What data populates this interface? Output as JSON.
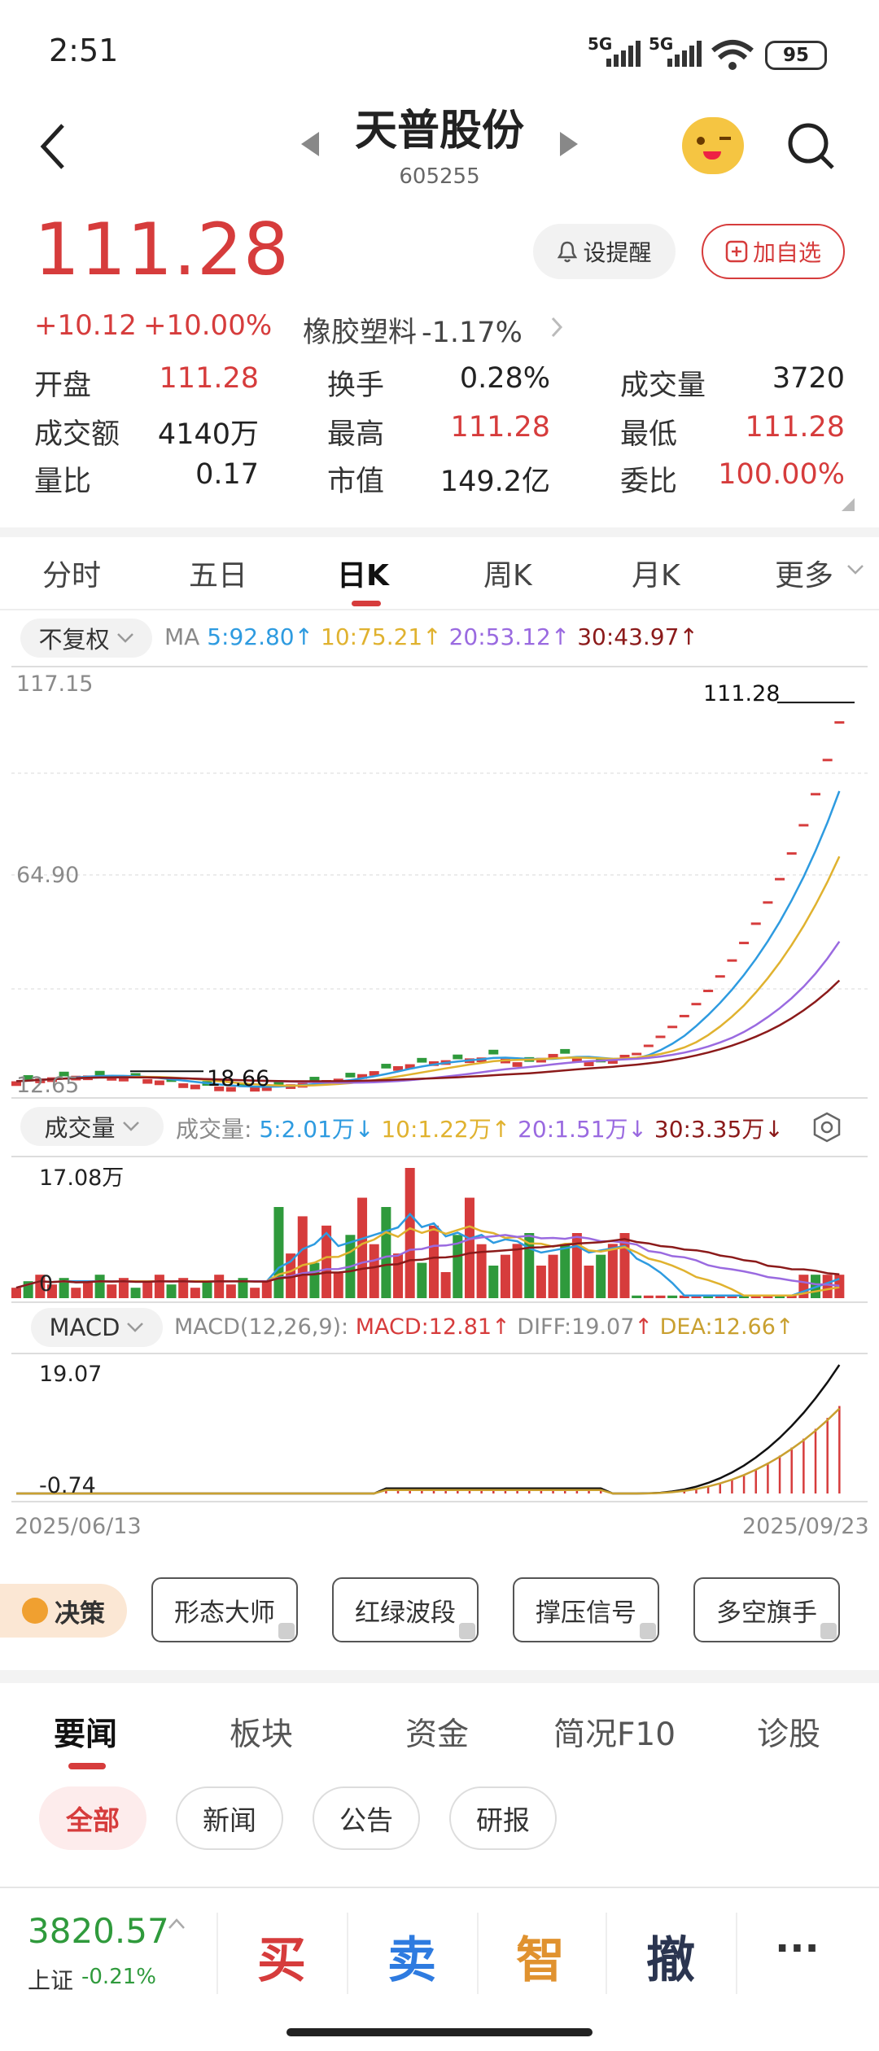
{
  "status": {
    "time": "2:51",
    "net1": "5G",
    "net2": "5G",
    "battery": "95"
  },
  "header": {
    "name": "天普股份",
    "code": "605255"
  },
  "quote": {
    "price": "111.28",
    "change": "+10.12",
    "pct": "+10.00%",
    "sector": "橡胶塑料",
    "sector_pct": "-1.17%",
    "alert": "设提醒",
    "watch": "加自选"
  },
  "stats": [
    {
      "k": "开盘",
      "v": "111.28",
      "c": "red"
    },
    {
      "k": "换手",
      "v": "0.28%",
      "c": "dark"
    },
    {
      "k": "成交量",
      "v": "3720",
      "c": "dark"
    },
    {
      "k": "成交额",
      "v": "4140万",
      "c": "dark"
    },
    {
      "k": "最高",
      "v": "111.28",
      "c": "red"
    },
    {
      "k": "最低",
      "v": "111.28",
      "c": "red"
    },
    {
      "k": "量比",
      "v": "0.17",
      "c": "dark"
    },
    {
      "k": "市值",
      "v": "149.2亿",
      "c": "dark"
    },
    {
      "k": "委比",
      "v": "100.00%",
      "c": "red"
    }
  ],
  "tabs": [
    "分时",
    "五日",
    "日K",
    "周K",
    "月K",
    "更多"
  ],
  "kline": {
    "adj": "不复权",
    "ma_label": "MA",
    "ma5": "5:92.80",
    "ma10": "10:75.21",
    "ma20": "20:53.12",
    "ma30": "30:43.97",
    "y_top": "117.15",
    "y_mid": "64.90",
    "y_bot": "12.65",
    "hi_label": "111.28",
    "lo_label": "18.66"
  },
  "vol": {
    "label": "成交量",
    "title": "成交量:",
    "v5": "5:2.01万",
    "v10": "10:1.22万",
    "v20": "20:1.51万",
    "v30": "30:3.35万",
    "y_top": "17.08万",
    "y_bot": "0"
  },
  "macd": {
    "label": "MACD",
    "params": "MACD(12,26,9):",
    "macd": "MACD:12.81",
    "diff": "DIFF:19.07",
    "dea": "DEA:12.66",
    "y_top": "19.07",
    "y_bot": "-0.74",
    "date_start": "2025/06/13",
    "date_end": "2025/09/23"
  },
  "tools": {
    "badge": "决策",
    "items": [
      "形态大师",
      "红绿波段",
      "撑压信号",
      "多空旗手"
    ]
  },
  "news": {
    "tabs": [
      "要闻",
      "板块",
      "资金",
      "简况F10",
      "诊股"
    ],
    "filters": [
      "全部",
      "新闻",
      "公告",
      "研报"
    ]
  },
  "bottom": {
    "index_val": "3820.57",
    "index_name": "上证",
    "index_pct": "-0.21%",
    "buy": "买",
    "sell": "卖",
    "smart": "智",
    "cancel": "撤",
    "more": "···"
  },
  "chart_data": {
    "type": "candlestick",
    "ylim": [
      12.65,
      117.15
    ],
    "x_start": "2025/06/13",
    "x_end": "2025/09/23",
    "last_close": 111.28,
    "min_label": 18.66
  }
}
